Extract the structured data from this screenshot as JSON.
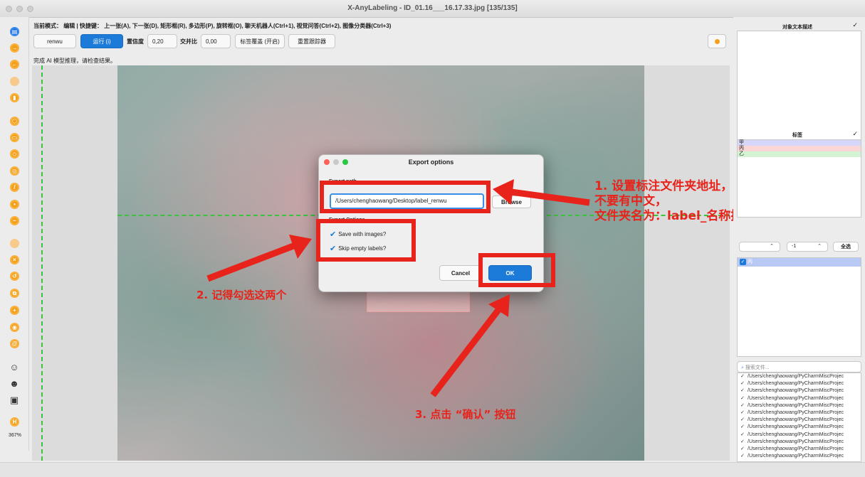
{
  "window": {
    "title": "X-AnyLabeling - ID_01.16___16.17.33.jpg [135/135]"
  },
  "header": {
    "mode_line": "当前模式：  编辑 | 快捷键：  上一张(A), 下一张(D), 矩形框(R), 多边形(P), 旋转框(O), 聊天机器人(Ctrl+1), 视觉问答(Ctrl+2), 图像分类器(Ctrl+3)",
    "model_name": "renwu",
    "run_label": "运行 (i)",
    "confidence_label": "置信度",
    "confidence_value": "0,20",
    "iou_label": "交并比",
    "iou_value": "0,00",
    "label_overwrite": "标签覆盖 (开启)",
    "reset_tracker": "重置跟踪器",
    "status": "完成 AI 模型推理，请检查结果。"
  },
  "toolbar": {
    "zoom": "367%"
  },
  "dialog": {
    "title": "Export options",
    "export_path_label": "Export path",
    "path_value": "/Users/chenghaowang/Desktop/label_renwu",
    "browse_label": "Browse",
    "export_options_label": "Export Options",
    "save_with_images": "Save with images?",
    "skip_empty_labels": "Skip empty labels?",
    "cancel_label": "Cancel",
    "ok_label": "OK"
  },
  "annotations": {
    "note1_line1": "1. 设置标注文件夹地址，",
    "note1_line2": "不要有中文，",
    "note1_line3": "文件夹名为：label_名称拼音",
    "note2": "2. 记得勾选这两个",
    "note3": "3. 点击 “确认” 按钮",
    "color": "#e8231b"
  },
  "right_panel": {
    "description_title": "对象文本描述",
    "labels_title": "标签",
    "labels": [
      {
        "name": "甲",
        "color": "#d6d6fb"
      },
      {
        "name": "丙",
        "color": "#fbd6d6"
      },
      {
        "name": "乙",
        "color": "#d3f3d3"
      }
    ],
    "group_value": "-1",
    "select_all": "全选",
    "shape_item": "丙",
    "search_placeholder": "搜索文件...",
    "files": [
      "/Users/chenghaowang/PyCharmMiscProjec",
      "/Users/chenghaowang/PyCharmMiscProjec",
      "/Users/chenghaowang/PyCharmMiscProjec",
      "/Users/chenghaowang/PyCharmMiscProjec",
      "/Users/chenghaowang/PyCharmMiscProjec",
      "/Users/chenghaowang/PyCharmMiscProjec",
      "/Users/chenghaowang/PyCharmMiscProjec",
      "/Users/chenghaowang/PyCharmMiscProjec",
      "/Users/chenghaowang/PyCharmMiscProjec",
      "/Users/chenghaowang/PyCharmMiscProjec",
      "/Users/chenghaowang/PyCharmMiscProjec",
      "/Users/chenghaowang/PyCharmMiscProjec"
    ]
  }
}
